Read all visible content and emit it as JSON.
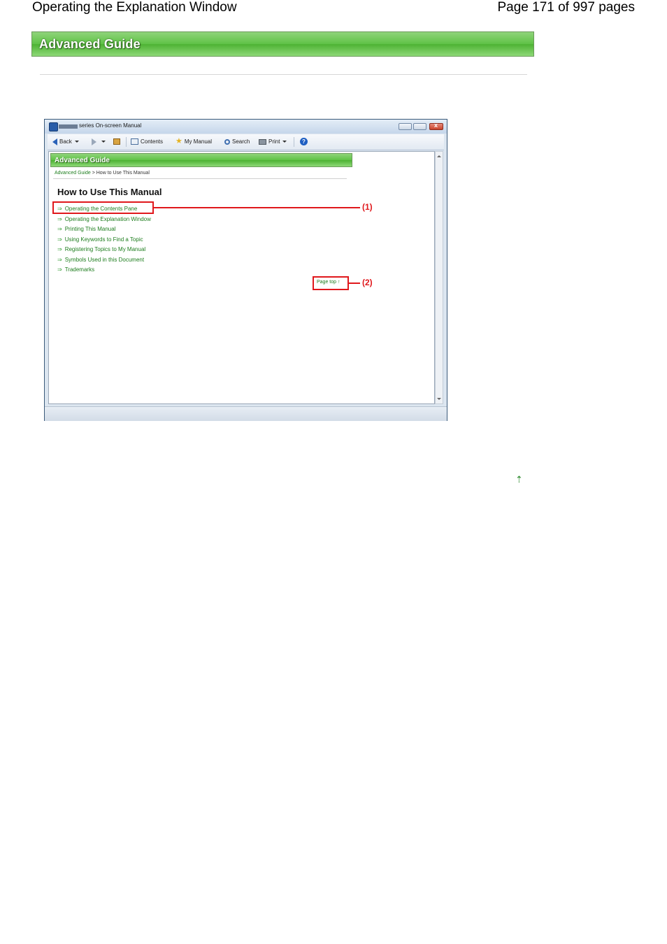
{
  "header": {
    "title": "Operating the Explanation Window",
    "page_info": "Page 171 of 997 pages"
  },
  "banner": {
    "label": "Advanced Guide"
  },
  "screenshot": {
    "window_title": "series On-screen Manual",
    "toolbar": {
      "back": "Back",
      "contents": "Contents",
      "my_manual": "My Manual",
      "search": "Search",
      "print": "Print"
    },
    "banner": "Advanced Guide",
    "breadcrumb": {
      "link": "Advanced Guide",
      "separator": " > ",
      "current": "How to Use This Manual"
    },
    "heading": "How to Use This Manual",
    "links": [
      "Operating the Contents Pane",
      "Operating the Explanation Window",
      "Printing This Manual",
      "Using Keywords to Find a Topic",
      "Registering Topics to My Manual",
      "Symbols Used in this Document",
      "Trademarks"
    ],
    "page_top": "Page top ↑",
    "callouts": [
      "(1)",
      "(2)"
    ]
  },
  "page_top_icon": "⇡"
}
